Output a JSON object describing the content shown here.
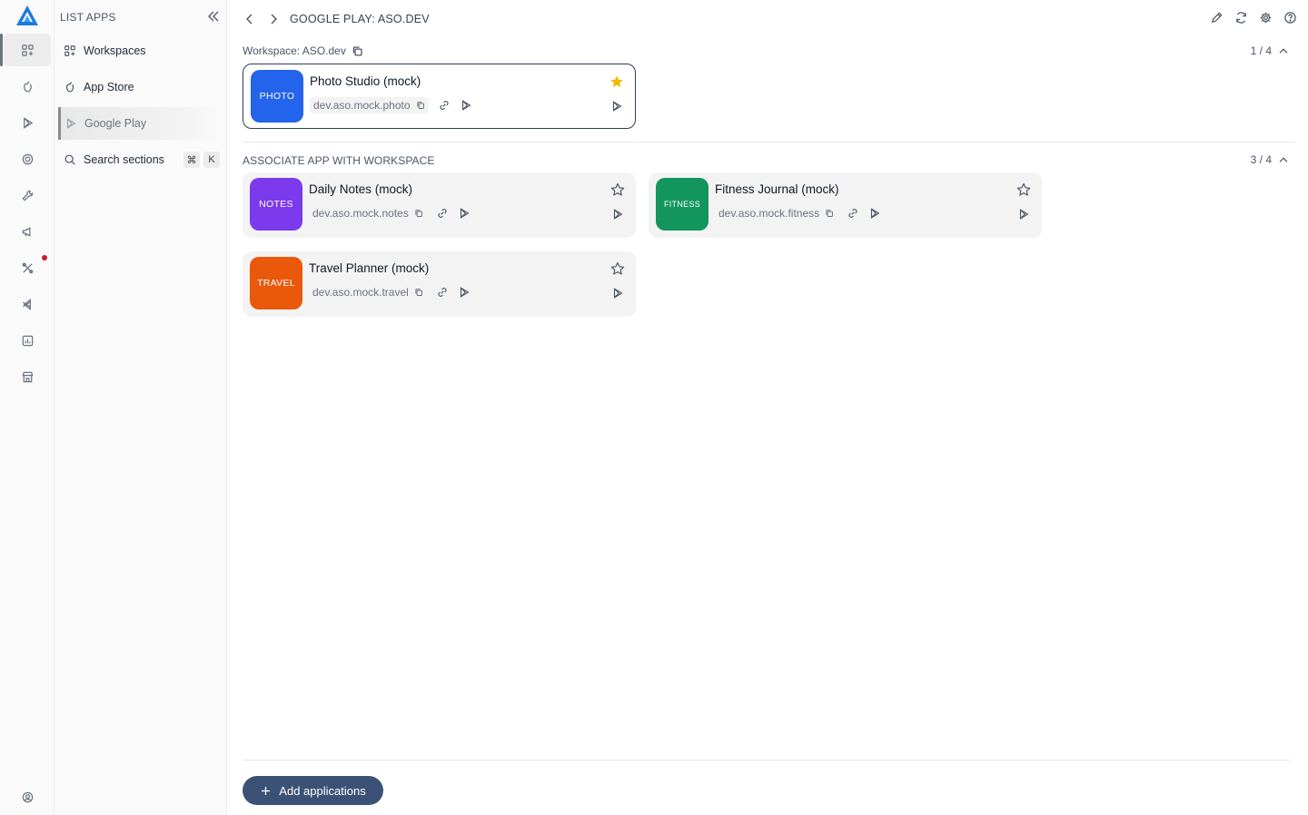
{
  "sidebar": {
    "title": "LIST APPS",
    "items": [
      {
        "label": "Workspaces",
        "icon": "grid-icon"
      },
      {
        "label": "App Store",
        "icon": "apple-icon"
      },
      {
        "label": "Google Play",
        "icon": "play-icon"
      },
      {
        "label": "Search sections",
        "icon": "search-icon",
        "shortcut": [
          "⌘",
          "K"
        ]
      }
    ]
  },
  "rail": {
    "icons": [
      "grid-icon",
      "apple-icon",
      "play-icon",
      "target-icon",
      "wrench-icon",
      "megaphone-icon",
      "tools-icon",
      "vscode-icon",
      "chart-icon",
      "store-icon",
      "user-circle-icon"
    ]
  },
  "header": {
    "breadcrumb": "GOOGLE PLAY: ASO.DEV",
    "actions": [
      "pencil-icon",
      "refresh-icon",
      "gear-icon",
      "help-icon"
    ]
  },
  "workspace": {
    "label": "Workspace: ASO.dev",
    "count": "1 / 4",
    "apps": [
      {
        "icon_text": "PHOTO",
        "color": "#2463eb",
        "name": "Photo Studio (mock)",
        "package": "dev.aso.mock.photo",
        "favorite": true
      }
    ]
  },
  "associate": {
    "title": "ASSOCIATE APP WITH WORKSPACE",
    "count": "3 / 4",
    "apps": [
      {
        "icon_text": "NOTES",
        "color": "#7c3aed",
        "name": "Daily Notes (mock)",
        "package": "dev.aso.mock.notes",
        "favorite": false
      },
      {
        "icon_text": "FITNESS",
        "color": "#12965e",
        "name": "Fitness Journal (mock)",
        "package": "dev.aso.mock.fitness",
        "favorite": false
      },
      {
        "icon_text": "TRAVEL",
        "color": "#ea580c",
        "name": "Travel Planner (mock)",
        "package": "dev.aso.mock.travel",
        "favorite": false
      }
    ]
  },
  "footer": {
    "add_label": "Add applications"
  },
  "colors": {
    "accent": "#3b5276",
    "favorite_star": "#f5b800",
    "notification_dot": "#d11a2a"
  }
}
